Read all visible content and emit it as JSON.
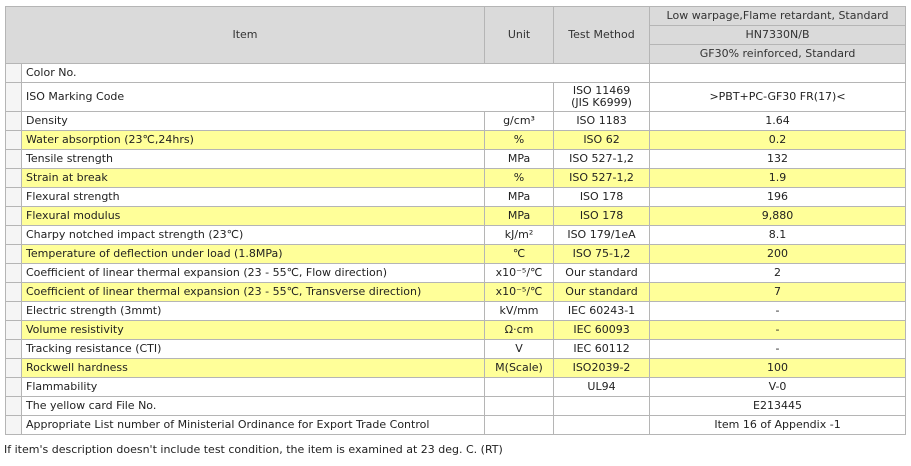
{
  "header": {
    "item": "Item",
    "unit": "Unit",
    "test_method": "Test Method",
    "grade_desc": "Low warpage,Flame retardant, Standard",
    "grade_name": "HN7330N/B",
    "grade_reinf": "GF30% reinforced, Standard"
  },
  "rows": [
    {
      "item": "Color No.",
      "unit": "",
      "method": "",
      "value": "",
      "yellow": false
    },
    {
      "item": "ISO Marking Code",
      "unit": "",
      "method": "ISO 11469",
      "method2": "(JIS K6999)",
      "value": ">PBT+PC-GF30 FR(17)<",
      "yellow": false
    },
    {
      "item": "Density",
      "unit": "g/cm³",
      "method": "ISO 1183",
      "value": "1.64",
      "yellow": false
    },
    {
      "item": "Water absorption (23℃,24hrs)",
      "unit": "%",
      "method": "ISO 62",
      "value": "0.2",
      "yellow": true
    },
    {
      "item": "Tensile strength",
      "unit": "MPa",
      "method": "ISO 527-1,2",
      "value": "132",
      "yellow": false
    },
    {
      "item": "Strain at break",
      "unit": "%",
      "method": "ISO 527-1,2",
      "value": "1.9",
      "yellow": true
    },
    {
      "item": "Flexural strength",
      "unit": "MPa",
      "method": "ISO 178",
      "value": "196",
      "yellow": false
    },
    {
      "item": "Flexural modulus",
      "unit": "MPa",
      "method": "ISO 178",
      "value": "9,880",
      "yellow": true
    },
    {
      "item": "Charpy notched impact strength (23℃)",
      "unit": "kJ/m²",
      "method": "ISO 179/1eA",
      "value": "8.1",
      "yellow": false
    },
    {
      "item": "Temperature of deflection under load (1.8MPa)",
      "unit": "℃",
      "method": "ISO 75-1,2",
      "value": "200",
      "yellow": true
    },
    {
      "item": "Coefficient of linear thermal expansion (23 - 55℃, Flow direction)",
      "unit": "x10⁻⁵/℃",
      "method": "Our standard",
      "value": "2",
      "yellow": false
    },
    {
      "item": "Coefficient of linear thermal expansion (23 - 55℃, Transverse direction)",
      "unit": "x10⁻⁵/℃",
      "method": "Our standard",
      "value": "7",
      "yellow": true
    },
    {
      "item": "Electric strength (3mmt)",
      "unit": "kV/mm",
      "method": "IEC 60243-1",
      "value": "-",
      "yellow": false
    },
    {
      "item": "Volume resistivity",
      "unit": "Ω·cm",
      "method": "IEC 60093",
      "value": "-",
      "yellow": true
    },
    {
      "item": "Tracking resistance (CTI)",
      "unit": "V",
      "method": "IEC 60112",
      "value": "-",
      "yellow": false
    },
    {
      "item": "Rockwell hardness",
      "unit": "M(Scale)",
      "method": "ISO2039-2",
      "value": "100",
      "yellow": true
    },
    {
      "item": "Flammability",
      "unit": "",
      "method": "UL94",
      "value": "V-0",
      "yellow": false
    },
    {
      "item": "The yellow card File No.",
      "unit": "",
      "method": "",
      "value": "E213445",
      "yellow": false
    },
    {
      "item": "Appropriate List number of Ministerial Ordinance for Export Trade Control",
      "unit": "",
      "method": "",
      "value": "Item 16 of Appendix -1",
      "yellow": false
    }
  ],
  "footnote": "If item's description doesn't include test condition, the item is examined at 23 deg. C. (RT)"
}
